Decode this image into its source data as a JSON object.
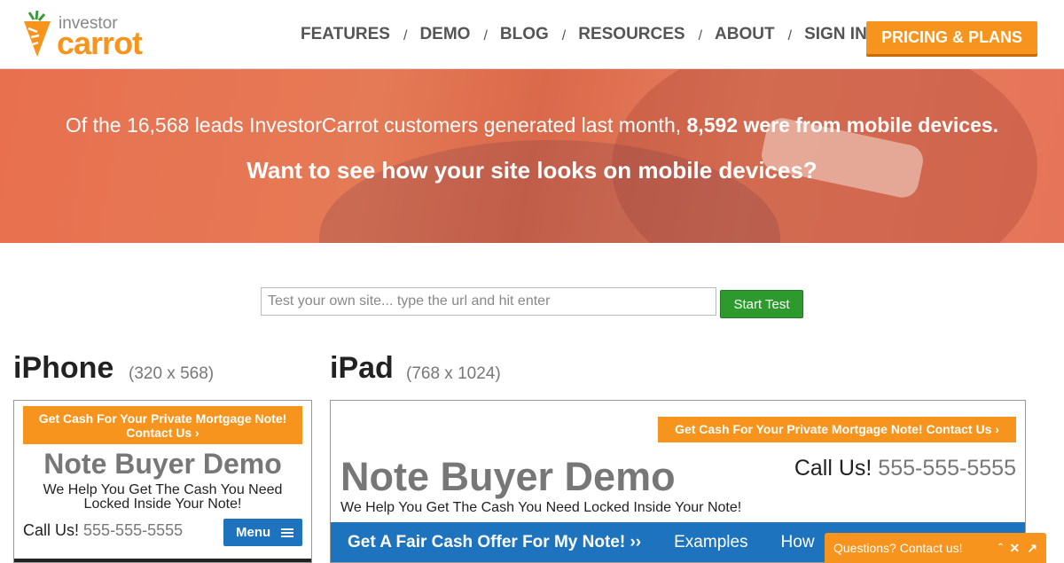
{
  "brand": {
    "small": "investor",
    "big": "carrot"
  },
  "nav": {
    "items": [
      "FEATURES",
      "DEMO",
      "BLOG",
      "RESOURCES",
      "ABOUT",
      "SIGN IN"
    ],
    "separator": "/",
    "pricing": "PRICING & PLANS"
  },
  "hero": {
    "line1_prefix": "Of the 16,568 leads InvestorCarrot customers generated last month, ",
    "line1_bold": "8,592 were from mobile devices.",
    "line2": "Want to see how your site looks on mobile devices?"
  },
  "test": {
    "placeholder": "Test your own site... type the url and hit enter",
    "button": "Start Test"
  },
  "iphone": {
    "title": "iPhone",
    "size": "(320 x 568)",
    "banner_line1": "Get Cash For Your Private Mortgage Note!",
    "banner_line2": "Contact Us ›",
    "site_title": "Note Buyer Demo",
    "tagline_line1": "We Help You Get The Cash You Need",
    "tagline_line2": "Locked Inside Your Note!",
    "call_label": "Call Us!",
    "phone": "555-555-5555",
    "menu": "Menu"
  },
  "ipad": {
    "title": "iPad",
    "size": "(768 x 1024)",
    "banner": "Get Cash For Your Private Mortgage Note! Contact Us ›",
    "site_title": "Note Buyer Demo",
    "tagline": "We Help You Get The Cash You Need Locked Inside Your Note!",
    "call_label": "Call Us!",
    "phone": "555-555-5555",
    "nav_cta": "Get A Fair Cash Offer For My Note! ››",
    "nav_examples": "Examples",
    "nav_how": "How"
  },
  "chat": {
    "label": "Questions? Contact us!",
    "icons": [
      "chevron-up-icon",
      "close-icon",
      "expand-icon"
    ]
  },
  "colors": {
    "orange": "#f7941d",
    "blue": "#1e73be",
    "green": "#2e9a2e"
  }
}
